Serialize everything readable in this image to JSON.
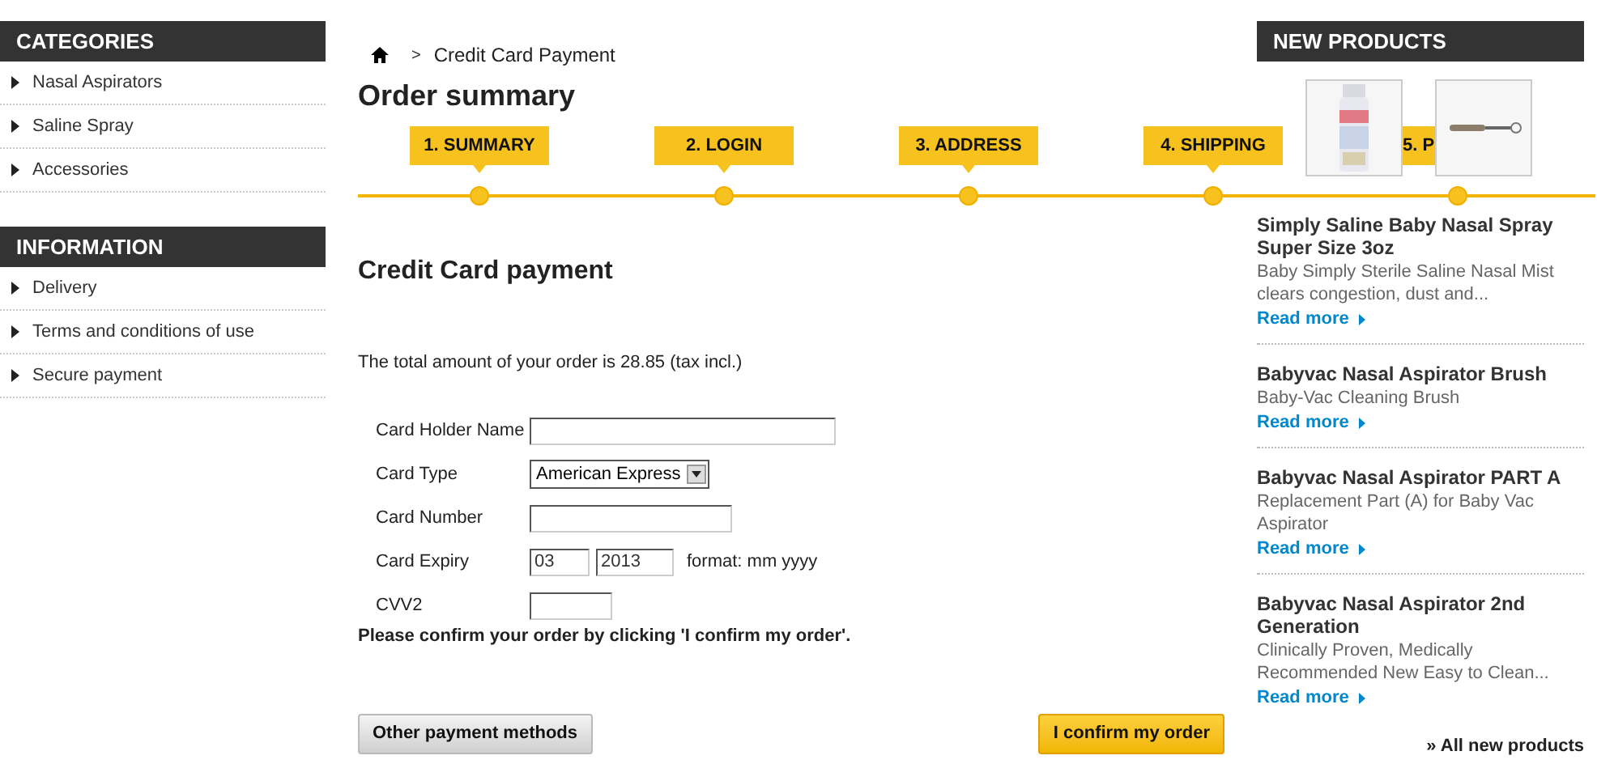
{
  "sidebar": [
    {
      "title": "CATEGORIES",
      "items": [
        "Nasal Aspirators",
        "Saline Spray",
        "Accessories"
      ]
    },
    {
      "title": "INFORMATION",
      "items": [
        "Delivery",
        "Terms and conditions of use",
        "Secure payment"
      ]
    }
  ],
  "breadcrumb": {
    "separator": ">",
    "current": "Credit Card Payment"
  },
  "heading": "Order summary",
  "steps": [
    "1. SUMMARY",
    "2. LOGIN",
    "3. ADDRESS",
    "4. SHIPPING",
    "5. P"
  ],
  "payment": {
    "title": "Credit Card payment",
    "total": "The total amount of your order is 28.85 (tax incl.)",
    "fields": [
      {
        "kind": "text",
        "label": "Card Holder Name"
      },
      {
        "kind": "select",
        "label": "Card Type",
        "value": "American Express"
      },
      {
        "kind": "text",
        "label": "Card Number"
      },
      {
        "kind": "expiry",
        "label": "Card Expiry",
        "month": "03",
        "year": "2013",
        "hint": "format: mm yyyy"
      },
      {
        "kind": "text",
        "label": "CVV2"
      }
    ],
    "confirm_note": "Please confirm your order by clicking 'I confirm my order'.",
    "buttons": {
      "other": "Other payment methods",
      "confirm": "I confirm my order"
    }
  },
  "new_products": {
    "title": "NEW PRODUCTS",
    "items": [
      {
        "name": "Simply Saline Baby Nasal Spray Super Size 3oz",
        "description": "Baby Simply Sterile Saline Nasal Mist clears congestion, dust and...",
        "link": "Read more"
      },
      {
        "name": "Babyvac Nasal Aspirator Brush",
        "description": "Baby-Vac Cleaning Brush",
        "link": "Read more"
      },
      {
        "name": "Babyvac Nasal Aspirator PART A",
        "description": "Replacement Part (A) for Baby Vac Aspirator",
        "link": "Read more"
      },
      {
        "name": "Babyvac Nasal Aspirator 2nd Generation",
        "description": "Clinically Proven, Medically Recommended New Easy to Clean...",
        "link": "Read more"
      }
    ],
    "all_link": "» All new products"
  }
}
